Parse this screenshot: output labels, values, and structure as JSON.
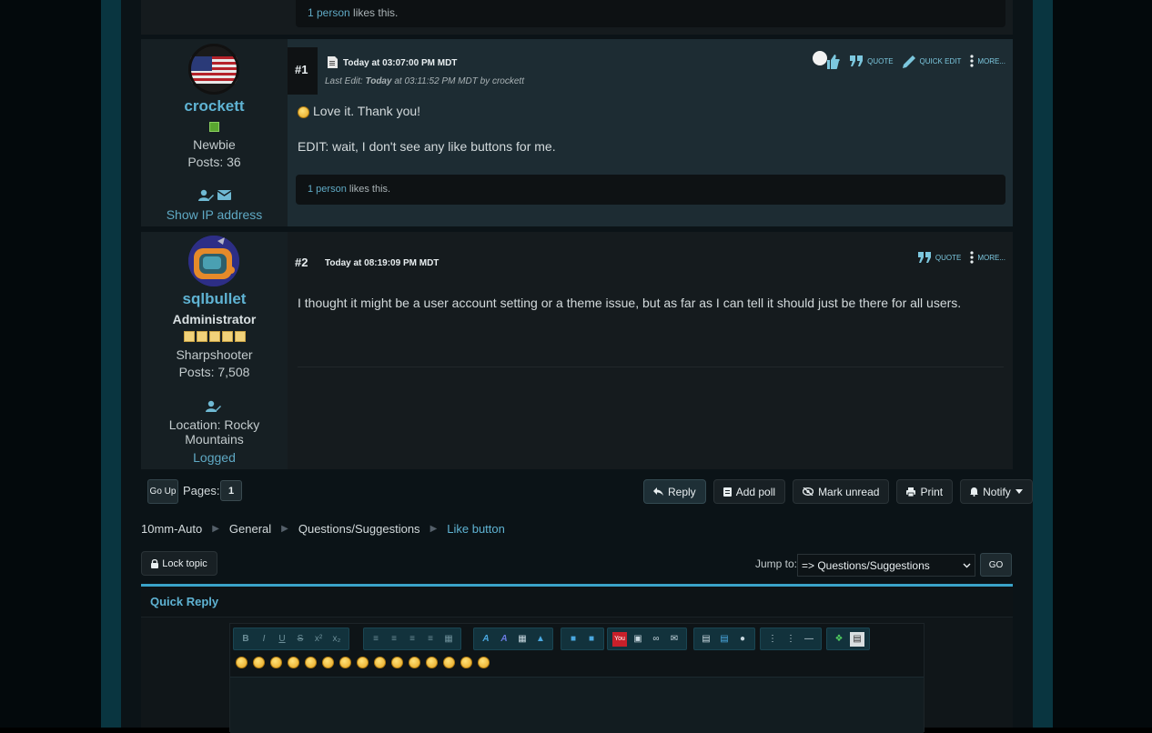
{
  "previous_post": {
    "likes_link": "1 person",
    "likes_suffix": " likes this."
  },
  "posts": [
    {
      "number": "#1",
      "username": "crockett",
      "rank": "Newbie",
      "posts": "Posts: 36",
      "ip_link": "Show IP address",
      "date": "Today at 03:07:00 PM MDT",
      "last_edit_prefix": "Last Edit: ",
      "last_edit_today": "Today",
      "last_edit_suffix": " at 03:11:52 PM MDT by crockett",
      "body_line1": "Love it. Thank you!",
      "body_line2": "EDIT: wait, I don't see any like buttons for me.",
      "likes_link": "1 person",
      "likes_suffix": " likes this.",
      "actions": {
        "quote": "QUOTE",
        "quick_edit": "QUICK EDIT",
        "more": "MORE..."
      }
    },
    {
      "number": "#2",
      "username": "sqlbullet",
      "group": "Administrator",
      "rank": "Sharpshooter",
      "posts": "Posts: 7,508",
      "location_line1": "Location: Rocky",
      "location_line2": "Mountains",
      "status": "Logged",
      "date": "Today at 08:19:09 PM MDT",
      "body": "I thought it might be a user account setting or a theme issue, but as far as I can tell it should just be there for all users.",
      "actions": {
        "quote": "QUOTE",
        "more": "MORE..."
      }
    }
  ],
  "nav": {
    "go_up": "Go Up",
    "pages_label": "Pages:",
    "current_page": "1",
    "buttons": {
      "reply": "Reply",
      "add_poll": "Add poll",
      "mark_unread": "Mark unread",
      "print": "Print",
      "notify": "Notify"
    }
  },
  "breadcrumb": [
    "10mm-Auto",
    "General",
    "Questions/Suggestions",
    "Like button"
  ],
  "lock_topic": "Lock topic",
  "jump": {
    "label": "Jump to:",
    "selected": "=> Questions/Suggestions",
    "go": "GO"
  },
  "quick_reply": {
    "title": "Quick Reply"
  },
  "colors": {
    "accent": "#3aa3c9",
    "link": "#5fb3d3",
    "post_highlight": "#1d2c33"
  }
}
